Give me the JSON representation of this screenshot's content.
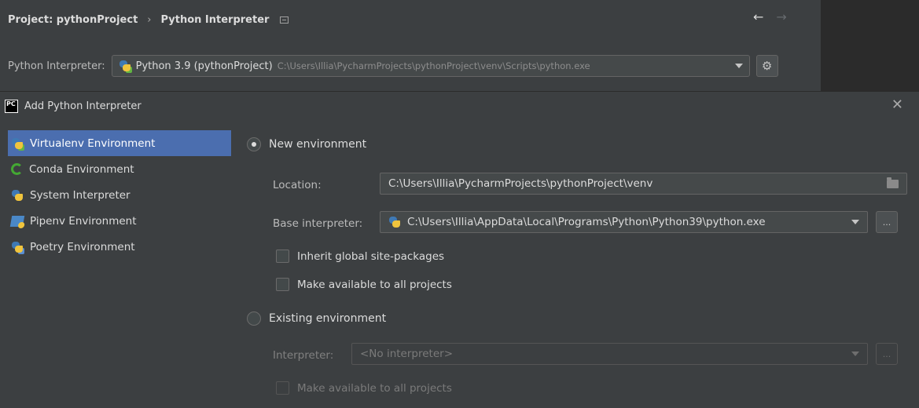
{
  "settings": {
    "breadcrumb": {
      "project": "Project: pythonProject",
      "separator": "›",
      "page": "Python Interpreter"
    },
    "nav": {
      "back": "←",
      "forward": "→"
    },
    "interpreter_label": "Python Interpreter:",
    "interpreter_name": "Python 3.9 (pythonProject)",
    "interpreter_path": "C:\\Users\\Illia\\PycharmProjects\\pythonProject\\venv\\Scripts\\python.exe",
    "gear": "⚙"
  },
  "dialog": {
    "title": "Add Python Interpreter",
    "app_icon_text": "PC",
    "close": "✕",
    "sidebar": {
      "items": [
        {
          "label": "Virtualenv Environment",
          "icon": "virtualenv-icon",
          "selected": true
        },
        {
          "label": "Conda Environment",
          "icon": "conda-icon"
        },
        {
          "label": "System Interpreter",
          "icon": "python-icon"
        },
        {
          "label": "Pipenv Environment",
          "icon": "pipenv-icon"
        },
        {
          "label": "Poetry Environment",
          "icon": "poetry-icon"
        }
      ]
    },
    "new_env": {
      "radio_label": "New environment",
      "selected": true,
      "location_label": "Location:",
      "location_value": "C:\\Users\\Illia\\PycharmProjects\\pythonProject\\venv",
      "base_label": "Base interpreter:",
      "base_value": "C:\\Users\\Illia\\AppData\\Local\\Programs\\Python\\Python39\\python.exe",
      "browse": "...",
      "inherit_label": "Inherit global site-packages",
      "make_available_label": "Make available to all projects"
    },
    "existing_env": {
      "radio_label": "Existing environment",
      "interpreter_label": "Interpreter:",
      "interpreter_placeholder": "<No interpreter>",
      "browse": "...",
      "make_available_label": "Make available to all projects"
    }
  }
}
